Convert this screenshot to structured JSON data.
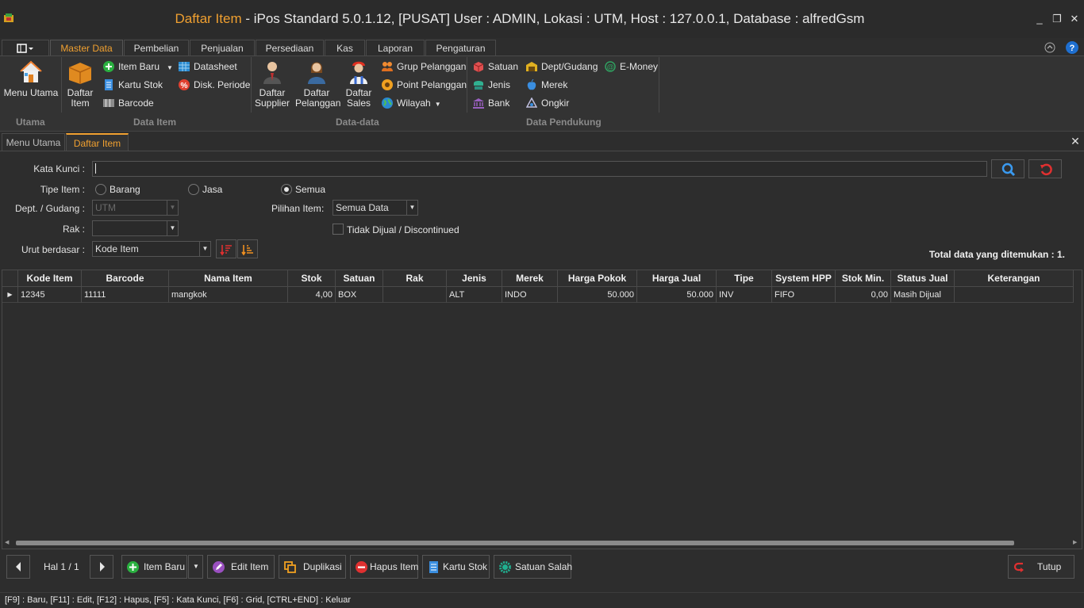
{
  "titlebar": {
    "title_accent": "Daftar Item",
    "title_rest": " - iPos Standard 5.0.1.12, [PUSAT] User : ADMIN, Lokasi : UTM, Host : 127.0.0.1, Database : alfredGsm",
    "minimize": "_",
    "restore": "❐",
    "close": "✕"
  },
  "ribbon_tabs": [
    "Master Data",
    "Pembelian",
    "Penjualan",
    "Persediaan",
    "Kas",
    "Laporan",
    "Pengaturan"
  ],
  "ribbon": {
    "utama": {
      "label": "Utama",
      "menu_utama": "Menu Utama"
    },
    "data_item": {
      "label": "Data Item",
      "daftar_item_1": "Daftar",
      "daftar_item_2": "Item",
      "item_baru": "Item Baru",
      "kartu_stok": "Kartu Stok",
      "barcode": "Barcode",
      "datasheet": "Datasheet",
      "disk_periode": "Disk. Periode"
    },
    "data_data": {
      "label": "Data-data",
      "supplier_1": "Daftar",
      "supplier_2": "Supplier",
      "pelanggan_1": "Daftar",
      "pelanggan_2": "Pelanggan",
      "sales_1": "Daftar",
      "sales_2": "Sales",
      "grup_pelanggan": "Grup Pelanggan",
      "point_pelanggan": "Point Pelanggan",
      "wilayah": "Wilayah"
    },
    "data_pendukung": {
      "label": "Data Pendukung",
      "satuan": "Satuan",
      "jenis": "Jenis",
      "bank": "Bank",
      "dept_gudang": "Dept/Gudang",
      "merek": "Merek",
      "ongkir": "Ongkir",
      "emoney": "E-Money"
    }
  },
  "doc_tabs": [
    "Menu Utama",
    "Daftar Item"
  ],
  "form": {
    "kata_kunci_label": "Kata Kunci :",
    "kata_kunci_value": "",
    "tipe_item_label": "Tipe Item :",
    "tipe_options": [
      "Barang",
      "Jasa",
      "Semua"
    ],
    "tipe_selected": "Semua",
    "dept_label": "Dept. / Gudang :",
    "dept_value": "UTM",
    "pilihan_label": "Pilihan Item",
    "pilihan_colon": ":",
    "pilihan_value": "Semua Data",
    "rak_label": "Rak :",
    "rak_value": "",
    "discontinued_label": "Tidak Dijual / Discontinued",
    "discontinued_checked": false,
    "urut_label": "Urut berdasar :",
    "urut_value": "Kode Item",
    "total_text": "Total data yang ditemukan : 1."
  },
  "grid": {
    "columns": [
      "Kode Item",
      "Barcode",
      "Nama Item",
      "Stok",
      "Satuan",
      "Rak",
      "Jenis",
      "Merek",
      "Harga Pokok",
      "Harga Jual",
      "Tipe",
      "System HPP",
      "Stok Min.",
      "Status Jual",
      "Keterangan"
    ],
    "rows": [
      {
        "kode": "12345",
        "barcode": "11111",
        "nama": "mangkok",
        "stok": "4,00",
        "satuan": "BOX",
        "rak": "",
        "jenis": "ALT",
        "merek": "INDO",
        "harga_pokok": "50.000",
        "harga_jual": "50.000",
        "tipe": "INV",
        "hpp": "FIFO",
        "stok_min": "0,00",
        "status": "Masih Dijual",
        "keterangan": ""
      }
    ]
  },
  "bottom": {
    "page": "Hal 1 / 1",
    "item_baru": "Item Baru",
    "edit_item": "Edit Item",
    "duplikasi": "Duplikasi",
    "hapus_item": "Hapus Item",
    "kartu_stok": "Kartu Stok",
    "satuan_salah": "Satuan Salah",
    "tutup": "Tutup"
  },
  "statusbar": "[F9] : Baru, [F11] : Edit, [F12] : Hapus, [F5] : Kata Kunci, [F6] : Grid, [CTRL+END] : Keluar",
  "colors": {
    "accent": "#f0a030",
    "background": "#2d2d2d"
  }
}
